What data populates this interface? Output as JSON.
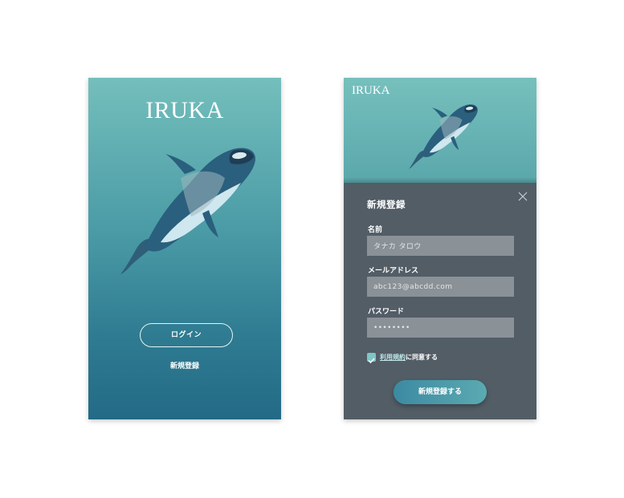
{
  "login_screen": {
    "brand": "IRUKA",
    "login_button": "ログイン",
    "register_link": "新規登録"
  },
  "register_screen": {
    "brand": "IRUKA",
    "title": "新規登録",
    "name": {
      "label": "名前",
      "value": "タナカ タロウ"
    },
    "email": {
      "label": "メールアドレス",
      "value": "abc123@abcdd.com"
    },
    "password": {
      "label": "パスワード",
      "value": "••••••••"
    },
    "terms_link": "利用規約",
    "terms_suffix": "に同意する",
    "terms_checked": true,
    "submit_button": "新規登録する",
    "close_icon": "close-icon"
  },
  "colors": {
    "teal_top": "#74bfbc",
    "teal_bottom": "#236a86",
    "modal_bg": "#525d66",
    "field_bg": "#8a9197",
    "accent": "#7fc6c6"
  }
}
